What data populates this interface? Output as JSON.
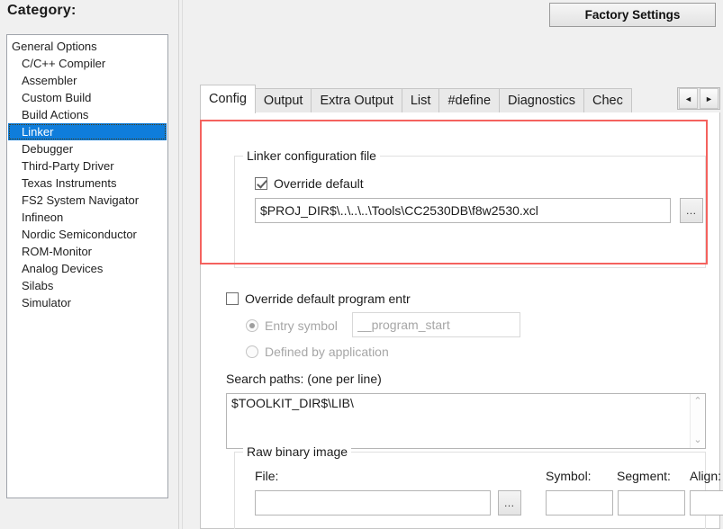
{
  "sidebar": {
    "title": "Category:",
    "items": [
      {
        "label": "General Options",
        "indent": false,
        "selected": false
      },
      {
        "label": "C/C++ Compiler",
        "indent": true,
        "selected": false
      },
      {
        "label": "Assembler",
        "indent": true,
        "selected": false
      },
      {
        "label": "Custom Build",
        "indent": true,
        "selected": false
      },
      {
        "label": "Build Actions",
        "indent": true,
        "selected": false
      },
      {
        "label": "Linker",
        "indent": true,
        "selected": true
      },
      {
        "label": "Debugger",
        "indent": true,
        "selected": false
      },
      {
        "label": "Third-Party Driver",
        "indent": true,
        "selected": false
      },
      {
        "label": "Texas Instruments",
        "indent": true,
        "selected": false
      },
      {
        "label": "FS2 System Navigator",
        "indent": true,
        "selected": false
      },
      {
        "label": "Infineon",
        "indent": true,
        "selected": false
      },
      {
        "label": "Nordic Semiconductor",
        "indent": true,
        "selected": false
      },
      {
        "label": "ROM-Monitor",
        "indent": true,
        "selected": false
      },
      {
        "label": "Analog Devices",
        "indent": true,
        "selected": false
      },
      {
        "label": "Silabs",
        "indent": true,
        "selected": false
      },
      {
        "label": "Simulator",
        "indent": true,
        "selected": false
      }
    ]
  },
  "toolbar": {
    "factory_settings_label": "Factory Settings"
  },
  "tabs": [
    {
      "label": "Config",
      "active": true
    },
    {
      "label": "Output",
      "active": false
    },
    {
      "label": "Extra Output",
      "active": false
    },
    {
      "label": "List",
      "active": false
    },
    {
      "label": "#define",
      "active": false
    },
    {
      "label": "Diagnostics",
      "active": false
    },
    {
      "label": "Chec",
      "active": false
    }
  ],
  "tab_scroll": {
    "left_arrow": "◄",
    "right_arrow": "►"
  },
  "config_page": {
    "linker_config_group": {
      "title": "Linker configuration file",
      "override_default": {
        "label": "Override default",
        "checked": true
      },
      "path_value": "$PROJ_DIR$\\..\\..\\..\\Tools\\CC2530DB\\f8w2530.xcl",
      "browse_label": "…"
    },
    "override_entry": {
      "label": "Override default program entr",
      "checked": false,
      "entry_symbol_radio_label": "Entry symbol",
      "entry_symbol_selected": true,
      "entry_symbol_value": "__program_start",
      "defined_by_app_radio_label": "Defined by application",
      "defined_by_app_selected": false
    },
    "search_paths": {
      "label": "Search paths:  (one per line)",
      "value": "$TOOLKIT_DIR$\\LIB\\",
      "scroll_up": "⌃",
      "scroll_down": "⌄"
    },
    "raw_binary_group": {
      "title": "Raw binary image",
      "file_label": "File:",
      "file_value": "",
      "file_browse_label": "…",
      "symbol_label": "Symbol:",
      "symbol_value": "",
      "segment_label": "Segment:",
      "segment_value": "",
      "align_label": "Align:",
      "align_value": ""
    }
  },
  "annotation": {
    "color": "#f4625e"
  }
}
